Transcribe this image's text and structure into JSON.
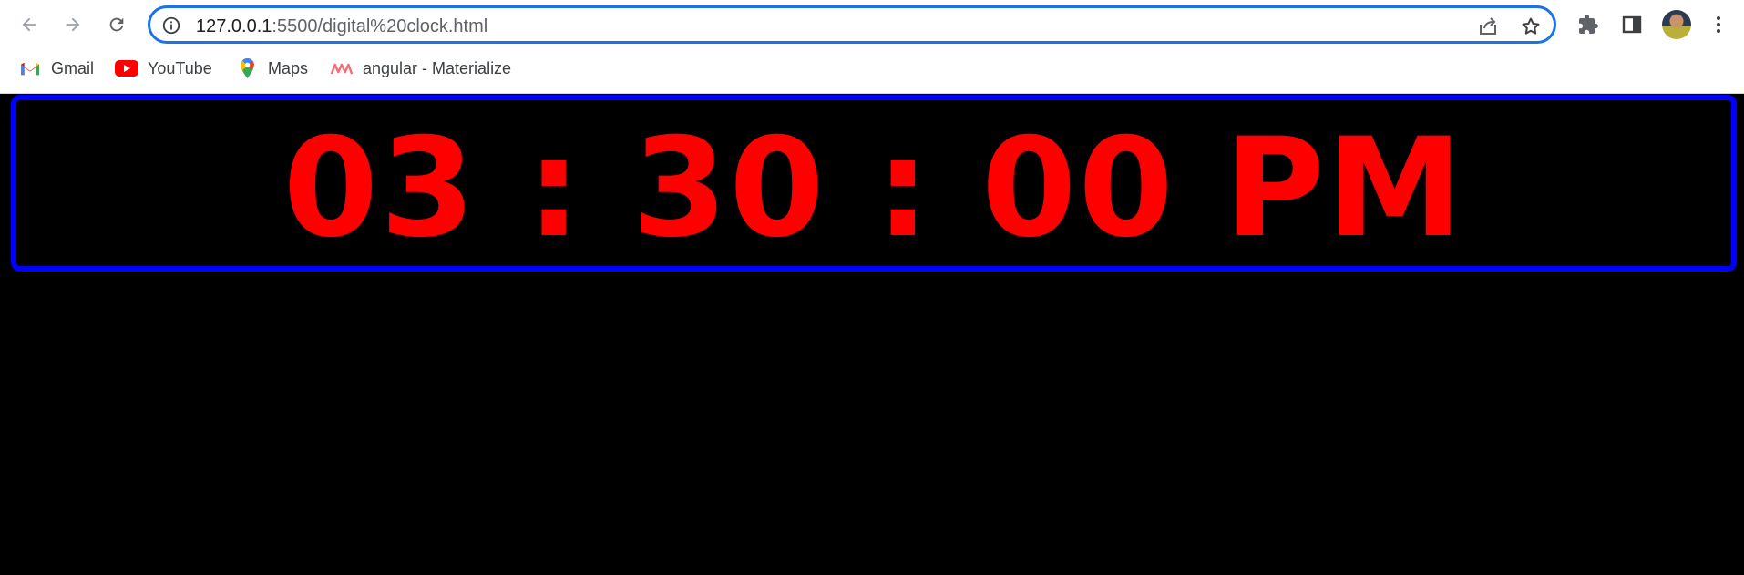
{
  "browser": {
    "url_host": "127.0.0.1",
    "url_path": ":5500/digital%20clock.html",
    "bookmarks": [
      {
        "label": "Gmail",
        "icon": "gmail-icon"
      },
      {
        "label": "YouTube",
        "icon": "youtube-icon"
      },
      {
        "label": "Maps",
        "icon": "maps-icon"
      },
      {
        "label": "angular - Materialize",
        "icon": "materialize-icon"
      }
    ]
  },
  "clock": {
    "time_text": "03 : 30 : 00 PM"
  },
  "colors": {
    "page_background": "#000000",
    "clock_text": "#ff0000",
    "clock_border": "#0000ff",
    "omnibox_focus": "#1a73e8"
  }
}
